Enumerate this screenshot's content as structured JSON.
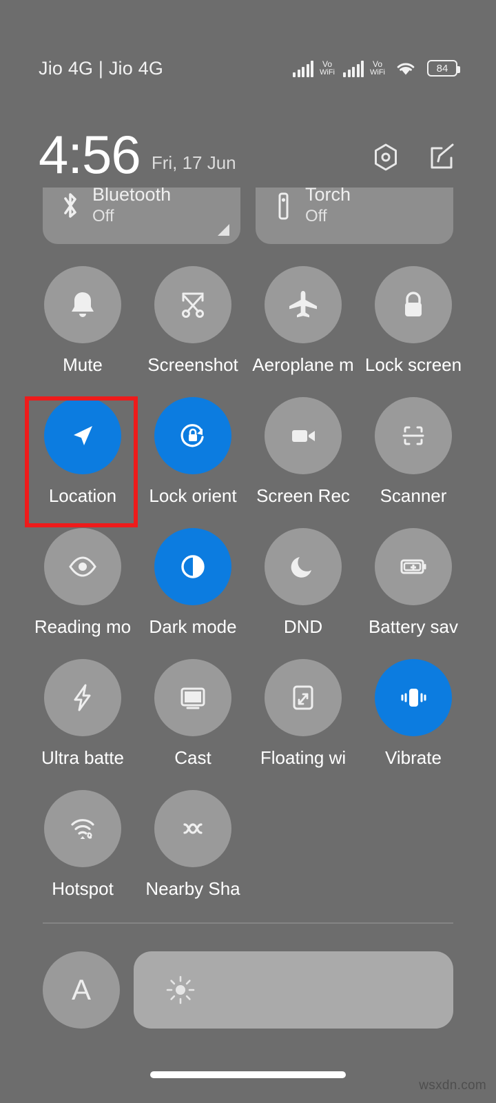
{
  "status_bar": {
    "carrier": "Jio 4G | Jio 4G",
    "signal_1": {
      "icon": "signal-bars-icon",
      "bars": 5
    },
    "volte_1": {
      "line1": "Vo",
      "line2": "WiFi"
    },
    "signal_2": {
      "icon": "signal-bars-icon",
      "bars": 5
    },
    "volte_2": {
      "line1": "Vo",
      "line2": "WiFi"
    },
    "wifi_icon": "wifi-icon",
    "battery": {
      "icon": "battery-icon",
      "level": "84"
    }
  },
  "header": {
    "time": "4:56",
    "date": "Fri, 17 Jun",
    "settings_icon": "settings-gear-icon",
    "edit_icon": "edit-pencil-icon"
  },
  "big_tiles": [
    {
      "title": "Bluetooth",
      "status": "Off",
      "icon": "bluetooth-icon",
      "expandable": true
    },
    {
      "title": "Torch",
      "status": "Off",
      "icon": "torch-icon",
      "expandable": false
    }
  ],
  "colors": {
    "background": "#6d6d6d",
    "tile_off": "#9a9a9a",
    "tile_on": "#0c7ce0",
    "highlight": "#ee1b1b",
    "slider_track": "#aaaaaa"
  },
  "tiles": [
    {
      "label": "Mute",
      "icon": "bell-icon",
      "active": false
    },
    {
      "label": "Screenshot",
      "icon": "scissors-icon",
      "active": false
    },
    {
      "label": "Aeroplane m",
      "icon": "aeroplane-icon",
      "active": false
    },
    {
      "label": "Lock screen",
      "icon": "padlock-icon",
      "active": false
    },
    {
      "label": "Location",
      "icon": "location-arrow-icon",
      "active": true
    },
    {
      "label": "Lock orient",
      "icon": "lock-rotation-icon",
      "active": true
    },
    {
      "label": "Screen Rec",
      "icon": "video-camera-icon",
      "active": false
    },
    {
      "label": "Scanner",
      "icon": "scan-frame-icon",
      "active": false
    },
    {
      "label": "Reading mo",
      "icon": "eye-icon",
      "active": false
    },
    {
      "label": "Dark mode",
      "icon": "contrast-circle-icon",
      "active": true
    },
    {
      "label": "DND",
      "icon": "moon-icon",
      "active": false
    },
    {
      "label": "Battery sav",
      "icon": "battery-plus-icon",
      "active": false
    },
    {
      "label": "Ultra batte",
      "icon": "lightning-bolt-icon",
      "active": false
    },
    {
      "label": "Cast",
      "icon": "monitor-icon",
      "active": false
    },
    {
      "label": "Floating wi",
      "icon": "floating-window-icon",
      "active": false
    },
    {
      "label": "Vibrate",
      "icon": "vibrate-phone-icon",
      "active": true
    },
    {
      "label": "Hotspot",
      "icon": "hotspot-icon",
      "active": false
    },
    {
      "label": "Nearby Sha",
      "icon": "nearby-share-icon",
      "active": false
    }
  ],
  "brightness": {
    "auto_label": "A",
    "auto_icon": "auto-brightness-icon",
    "slider_icon": "sun-icon",
    "value_percent": 4
  },
  "footer": {
    "home_indicator": "home-indicator",
    "watermark": "wsxdn.com"
  }
}
